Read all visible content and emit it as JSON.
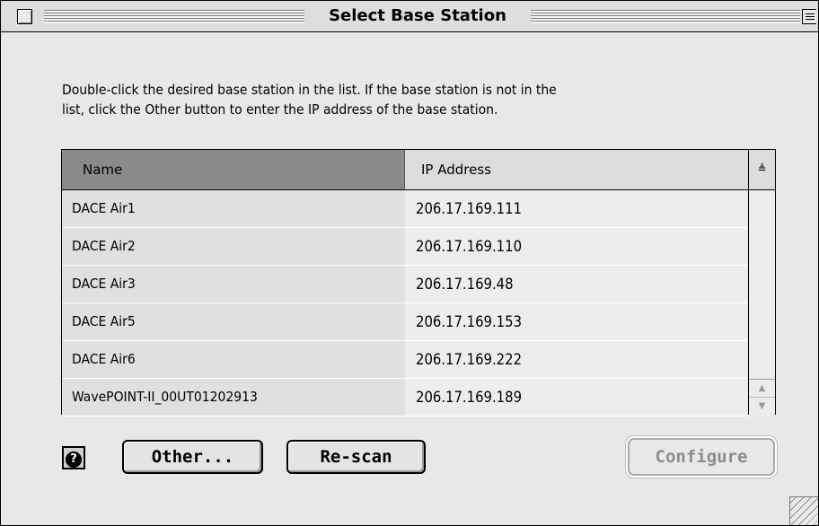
{
  "window": {
    "title": "Select Base Station"
  },
  "instructions": {
    "line1": "Double-click the desired base station in the list. If the base station is not in the",
    "line2": "list, click the Other button to enter the IP address of the base station."
  },
  "table": {
    "columns": [
      "Name",
      "IP Address"
    ],
    "rows": [
      {
        "name": "DACE Air1",
        "ip": "206.17.169.111"
      },
      {
        "name": "DACE Air2",
        "ip": "206.17.169.110"
      },
      {
        "name": "DACE Air3",
        "ip": "206.17.169.48"
      },
      {
        "name": "DACE Air5",
        "ip": "206.17.169.153"
      },
      {
        "name": "DACE Air6",
        "ip": "206.17.169.222"
      },
      {
        "name": "WavePOINT-II_00UT01202913",
        "ip": "206.17.169.189"
      }
    ],
    "sort_glyph": "≜"
  },
  "buttons": {
    "help": "?",
    "other": "Other...",
    "rescan": "Re-scan",
    "configure": "Configure"
  },
  "icons": {
    "close": "close-box-icon",
    "collapse": "collapse-box-icon",
    "help": "help-icon",
    "scroll_up": "scroll-up-arrow-icon",
    "scroll_down": "scroll-down-arrow-icon",
    "resize": "resize-grip-icon"
  },
  "colors": {
    "window_bg": "#e8e8e8",
    "selected_header": "#8a8a8a",
    "disabled_text": "#8c8c8c"
  }
}
